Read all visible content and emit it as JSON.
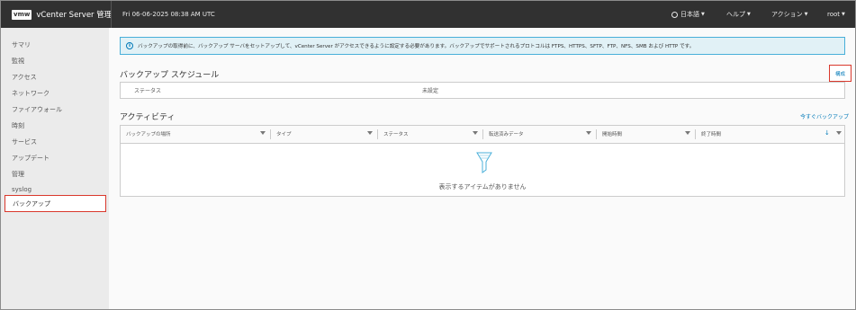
{
  "header": {
    "logo": "vmw",
    "title": "vCenter Server 管理",
    "datetime": "Fri 06-06-2025 08:38 AM UTC",
    "language": "日本語",
    "help": "ヘルプ",
    "actions": "アクション",
    "user": "root"
  },
  "sidebar": {
    "items": [
      {
        "label": "サマリ"
      },
      {
        "label": "監視"
      },
      {
        "label": "アクセス"
      },
      {
        "label": "ネットワーク"
      },
      {
        "label": "ファイアウォール"
      },
      {
        "label": "時刻"
      },
      {
        "label": "サービス"
      },
      {
        "label": "アップデート"
      },
      {
        "label": "管理"
      },
      {
        "label": "syslog"
      },
      {
        "label": "バックアップ",
        "selected": true
      }
    ]
  },
  "alert": {
    "icon": "info-icon",
    "text": "バックアップの取得前に、バックアップ サーバをセットアップして、vCenter Server がアクセスできるように設定する必要があります。バックアップでサポートされるプロトコルは FTPS、HTTPS、SFTP、FTP、NFS、SMB および HTTP です。"
  },
  "schedule": {
    "title": "バックアップ スケジュール",
    "configure_label": "構成",
    "status_key": "ステータス",
    "status_value": "未設定"
  },
  "activity": {
    "title": "アクティビティ",
    "backup_now_label": "今すぐバックアップ",
    "columns": [
      {
        "label": "バックアップの場所"
      },
      {
        "label": "タイプ"
      },
      {
        "label": "ステータス"
      },
      {
        "label": "転送済みデータ"
      },
      {
        "label": "開始時間"
      },
      {
        "label": "終了時間",
        "sorted": "descending"
      }
    ],
    "empty_text": "表示するアイテムがありません"
  },
  "colors": {
    "header_bg": "#313131",
    "accent": "#0079b8",
    "highlight_border": "#d9382c",
    "alert_bg": "#e1f1f6"
  }
}
